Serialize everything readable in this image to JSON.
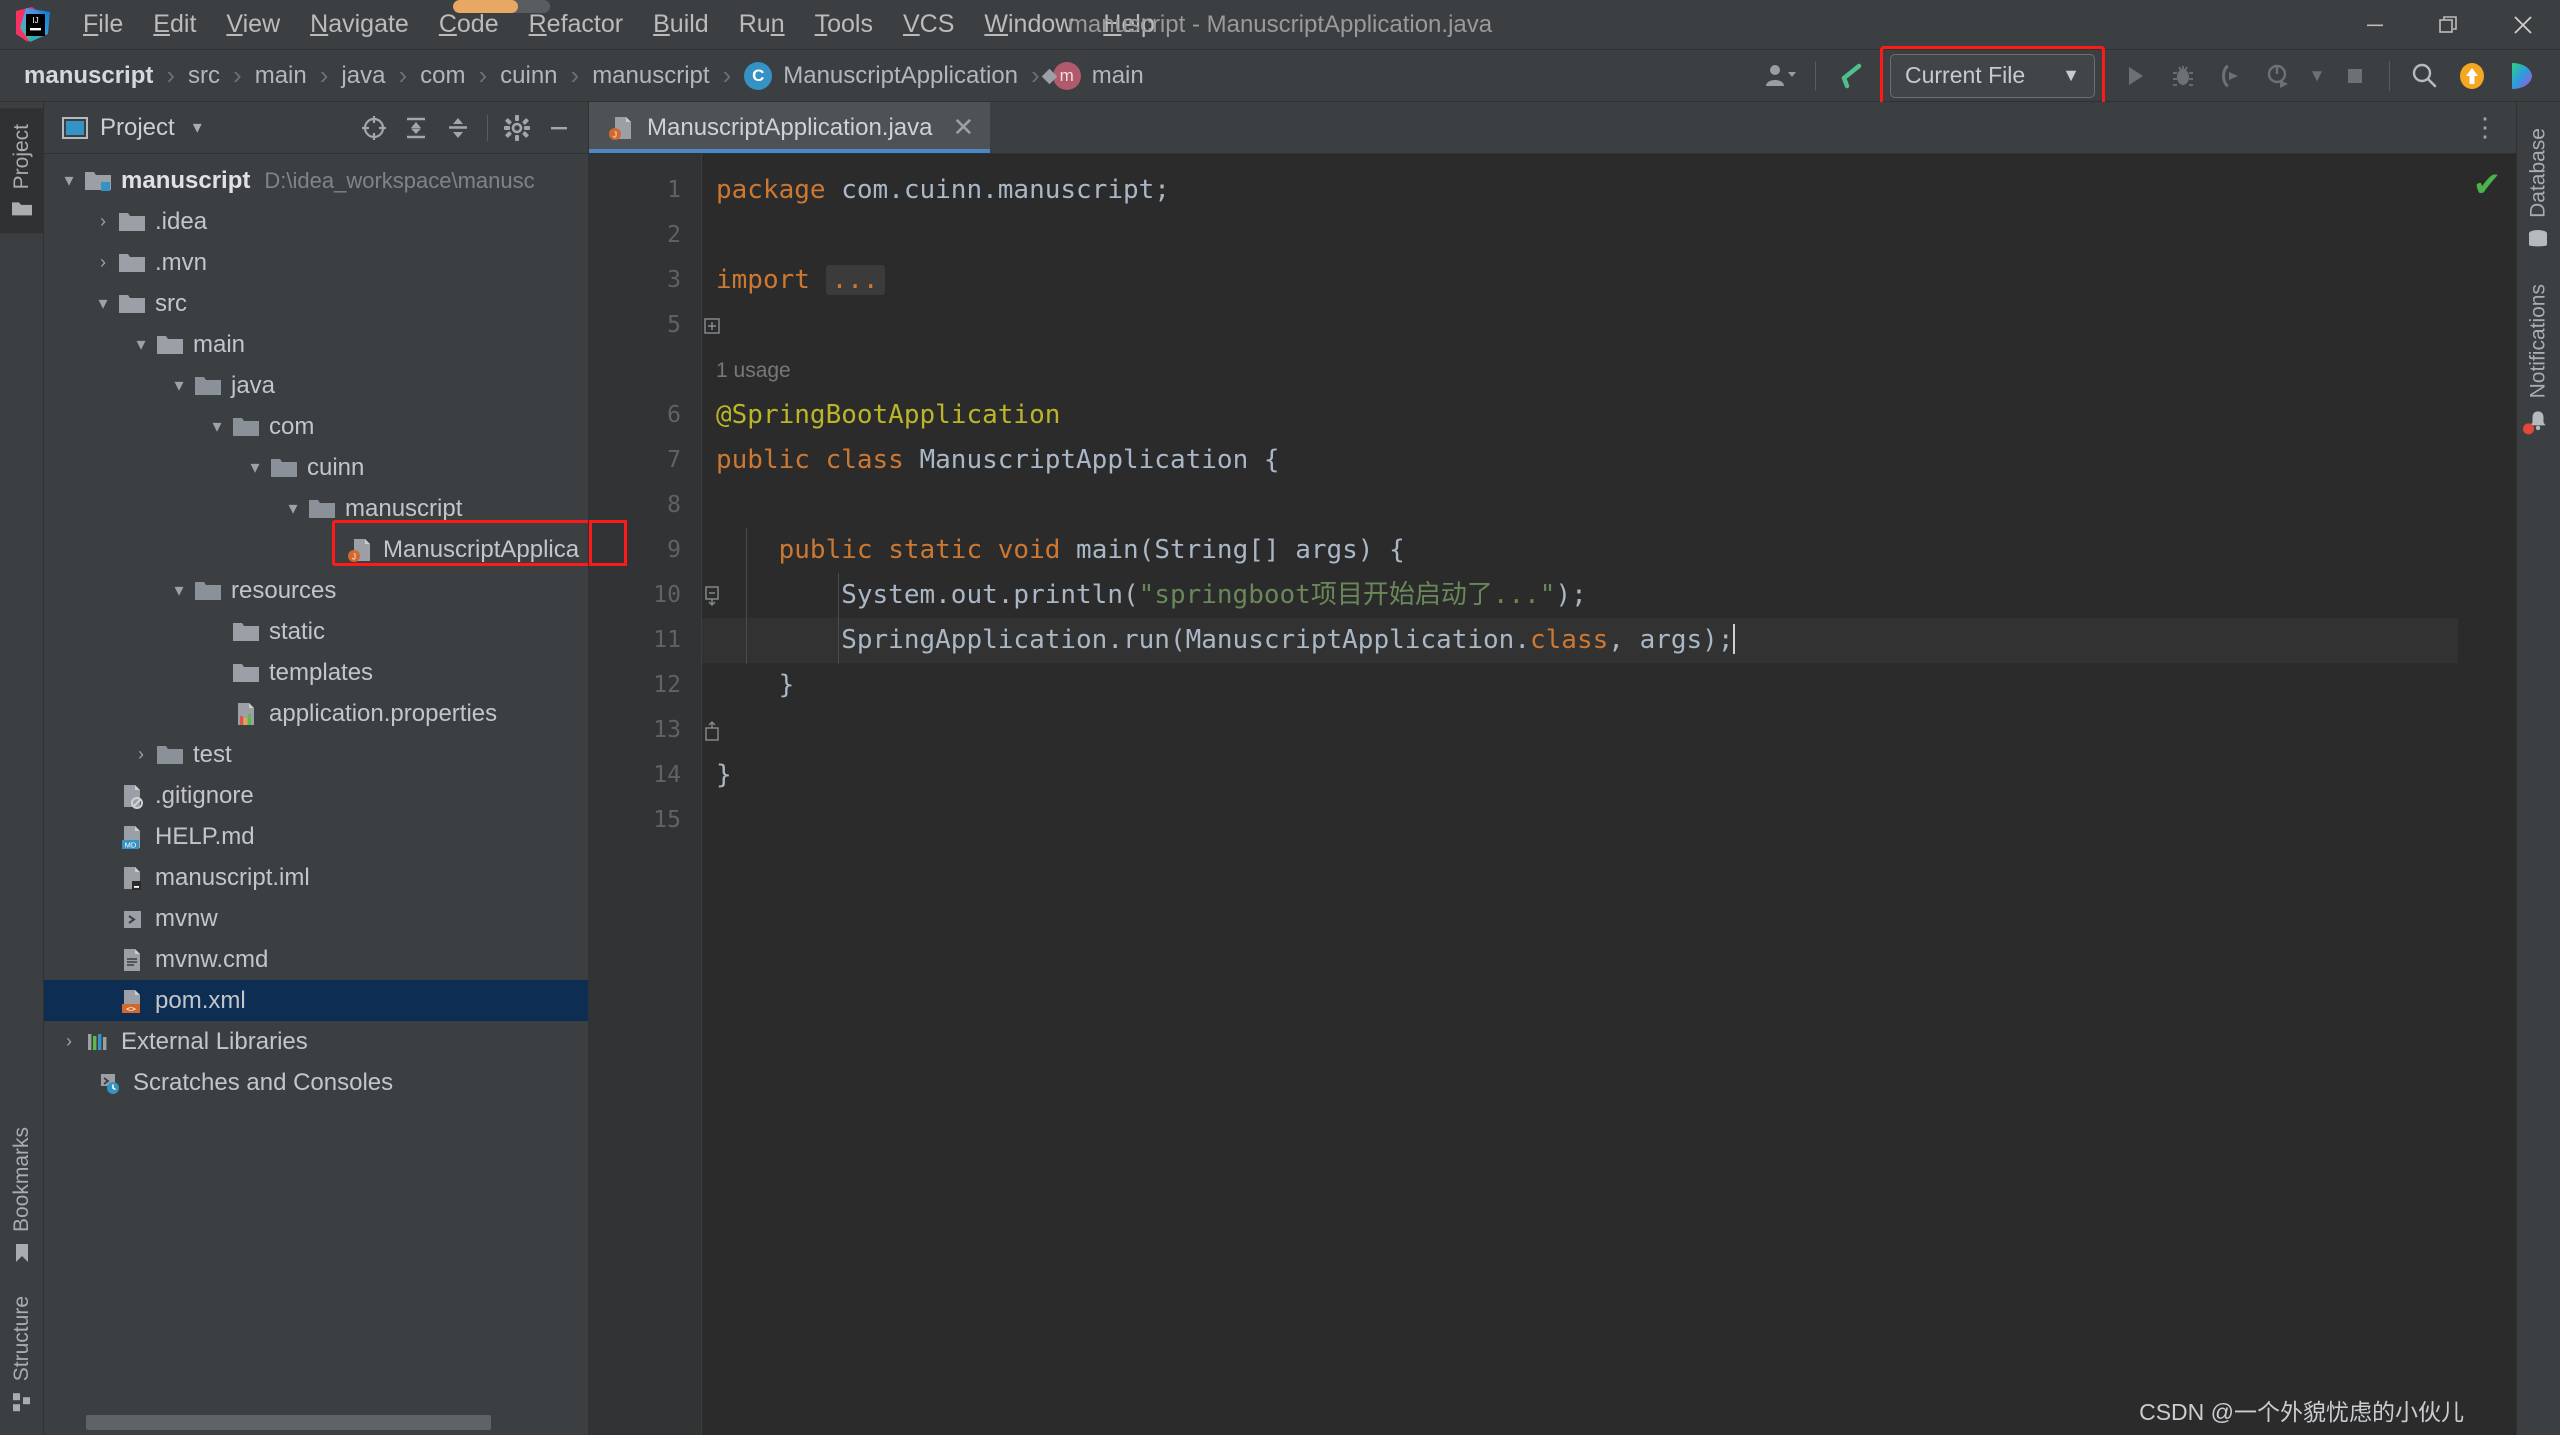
{
  "window": {
    "title": "manuscript - ManuscriptApplication.java",
    "minimize_label": "—",
    "maximize_label": "❐",
    "close_label": "✕"
  },
  "menubar": {
    "items": [
      {
        "label": "File",
        "mnemonic": "F"
      },
      {
        "label": "Edit",
        "mnemonic": "E"
      },
      {
        "label": "View",
        "mnemonic": "V"
      },
      {
        "label": "Navigate",
        "mnemonic": "N"
      },
      {
        "label": "Code",
        "mnemonic": "C"
      },
      {
        "label": "Refactor",
        "mnemonic": "R"
      },
      {
        "label": "Build",
        "mnemonic": "B"
      },
      {
        "label": "Run",
        "mnemonic": "n"
      },
      {
        "label": "Tools",
        "mnemonic": "T"
      },
      {
        "label": "VCS",
        "mnemonic": "V"
      },
      {
        "label": "Window",
        "mnemonic": "W"
      },
      {
        "label": "Help",
        "mnemonic": "H"
      }
    ]
  },
  "navbar": {
    "breadcrumbs": [
      {
        "label": "manuscript",
        "bold": true,
        "icon": "none"
      },
      {
        "label": "src",
        "bold": false,
        "icon": "none"
      },
      {
        "label": "main",
        "bold": false,
        "icon": "none"
      },
      {
        "label": "java",
        "bold": false,
        "icon": "none"
      },
      {
        "label": "com",
        "bold": false,
        "icon": "none"
      },
      {
        "label": "cuinn",
        "bold": false,
        "icon": "none"
      },
      {
        "label": "manuscript",
        "bold": false,
        "icon": "none"
      },
      {
        "label": "ManuscriptApplication",
        "bold": false,
        "icon": "class-badge",
        "badge": "C"
      },
      {
        "label": "main",
        "bold": false,
        "icon": "method-badge",
        "badge": "m"
      }
    ],
    "separator": "›",
    "run_config": {
      "label": "Current File",
      "dropdown_arrow": "▼",
      "highlight_color": "#ff1a1a"
    },
    "icons": {
      "user_avatar": "user-avatar-icon",
      "update_check": "checkmark-arrow-icon",
      "run": "run-icon",
      "debug": "debug-icon",
      "run_coverage": "run-with-coverage-icon",
      "profiler": "profiler-icon",
      "profiler_arrow": "▼",
      "stop": "stop-icon",
      "search": "search-everywhere-icon",
      "updates": "updates-icon",
      "ai_assistant": "ai-assistant-icon"
    }
  },
  "left_rail": {
    "top": [
      {
        "label": "Project",
        "icon": "folder-icon",
        "active": true
      }
    ],
    "bottom": [
      {
        "label": "Bookmarks",
        "icon": "bookmark-icon",
        "active": false
      },
      {
        "label": "Structure",
        "icon": "structure-icon",
        "active": false
      }
    ]
  },
  "right_rail": {
    "items": [
      {
        "label": "Database",
        "icon": "database-icon",
        "badge": false
      },
      {
        "label": "Notifications",
        "icon": "bell-icon",
        "badge": true
      }
    ]
  },
  "project_panel": {
    "title": "Project",
    "dropdown_arrow": "▾",
    "toolbar": [
      {
        "name": "select-opened-file-icon",
        "glyph": "⊕"
      },
      {
        "name": "expand-all-icon",
        "glyph": "⇲"
      },
      {
        "name": "collapse-all-icon",
        "glyph": "⇱"
      },
      {
        "name": "settings-gear-icon",
        "glyph": "⚙"
      },
      {
        "name": "hide-panel-icon",
        "glyph": "—"
      }
    ],
    "tree": [
      {
        "label": "manuscript",
        "note": "D:\\idea_workspace\\manusc",
        "depth": 0,
        "arrow": "down",
        "icon": "module-folder-icon",
        "bold": true,
        "selected": false
      },
      {
        "label": ".idea",
        "note": "",
        "depth": 1,
        "arrow": "right",
        "icon": "folder-icon",
        "bold": false,
        "selected": false
      },
      {
        "label": ".mvn",
        "note": "",
        "depth": 1,
        "arrow": "right",
        "icon": "folder-icon",
        "bold": false,
        "selected": false
      },
      {
        "label": "src",
        "note": "",
        "depth": 1,
        "arrow": "down",
        "icon": "folder-icon",
        "bold": false,
        "selected": false
      },
      {
        "label": "main",
        "note": "",
        "depth": 2,
        "arrow": "down",
        "icon": "folder-icon",
        "bold": false,
        "selected": false
      },
      {
        "label": "java",
        "note": "",
        "depth": 3,
        "arrow": "down",
        "icon": "source-folder-icon",
        "bold": false,
        "selected": false
      },
      {
        "label": "com",
        "note": "",
        "depth": 4,
        "arrow": "down",
        "icon": "package-folder-icon",
        "bold": false,
        "selected": false
      },
      {
        "label": "cuinn",
        "note": "",
        "depth": 5,
        "arrow": "down",
        "icon": "package-folder-icon",
        "bold": false,
        "selected": false
      },
      {
        "label": "manuscript",
        "note": "",
        "depth": 6,
        "arrow": "down",
        "icon": "package-folder-icon",
        "bold": false,
        "selected": false
      },
      {
        "label": "ManuscriptApplica",
        "note": "",
        "depth": 7,
        "arrow": "none",
        "icon": "java-spring-class-icon",
        "bold": false,
        "selected": false,
        "highlighted": true
      },
      {
        "label": "resources",
        "note": "",
        "depth": 3,
        "arrow": "down",
        "icon": "resource-folder-icon",
        "bold": false,
        "selected": false
      },
      {
        "label": "static",
        "note": "",
        "depth": 4,
        "arrow": "none",
        "icon": "folder-icon",
        "bold": false,
        "selected": false
      },
      {
        "label": "templates",
        "note": "",
        "depth": 4,
        "arrow": "none",
        "icon": "folder-icon",
        "bold": false,
        "selected": false
      },
      {
        "label": "application.properties",
        "note": "",
        "depth": 4,
        "arrow": "none",
        "icon": "properties-file-icon",
        "bold": false,
        "selected": false
      },
      {
        "label": "test",
        "note": "",
        "depth": 2,
        "arrow": "right",
        "icon": "test-folder-icon",
        "bold": false,
        "selected": false
      },
      {
        "label": ".gitignore",
        "note": "",
        "depth": 1,
        "arrow": "none",
        "icon": "gitignore-file-icon",
        "bold": false,
        "selected": false
      },
      {
        "label": "HELP.md",
        "note": "",
        "depth": 1,
        "arrow": "none",
        "icon": "markdown-file-icon",
        "bold": false,
        "selected": false
      },
      {
        "label": "manuscript.iml",
        "note": "",
        "depth": 1,
        "arrow": "none",
        "icon": "iml-file-icon",
        "bold": false,
        "selected": false
      },
      {
        "label": "mvnw",
        "note": "",
        "depth": 1,
        "arrow": "none",
        "icon": "shell-script-icon",
        "bold": false,
        "selected": false
      },
      {
        "label": "mvnw.cmd",
        "note": "",
        "depth": 1,
        "arrow": "none",
        "icon": "cmd-file-icon",
        "bold": false,
        "selected": false
      },
      {
        "label": "pom.xml",
        "note": "",
        "depth": 1,
        "arrow": "none",
        "icon": "xml-file-icon",
        "bold": false,
        "selected": true
      },
      {
        "label": "External Libraries",
        "note": "",
        "depth": 0,
        "arrow": "right",
        "icon": "libraries-icon",
        "bold": false,
        "selected": false
      },
      {
        "label": "Scratches and Consoles",
        "note": "",
        "depth": 0,
        "arrow": "none",
        "icon": "scratches-icon",
        "bold": false,
        "selected": false
      }
    ]
  },
  "editor": {
    "tab": {
      "label": "ManuscriptApplication.java",
      "icon": "java-spring-class-icon",
      "close": "✕"
    },
    "options_icon": "⋮",
    "inspection_status": "✔",
    "line_numbers": [
      "1",
      "2",
      "3",
      "5",
      "6",
      "7",
      "8",
      "9",
      "10",
      "11",
      "12",
      "13",
      "14",
      "15"
    ],
    "usage_hint": "1 usage",
    "code_lines": [
      {
        "n": "1",
        "tokens": [
          {
            "t": "package ",
            "c": "kw"
          },
          {
            "t": "com.cuinn.manuscript;",
            "c": "txt"
          }
        ]
      },
      {
        "n": "2",
        "tokens": []
      },
      {
        "n": "3",
        "tokens": [
          {
            "t": "import ",
            "c": "kw"
          },
          {
            "t": "...",
            "c": "folded"
          }
        ],
        "fold": "plus"
      },
      {
        "n": "5",
        "tokens": []
      },
      {
        "n": "usage",
        "tokens": [
          {
            "t": "1 usage",
            "c": "hint"
          }
        ]
      },
      {
        "n": "6",
        "tokens": [
          {
            "t": "@SpringBootApplication",
            "c": "ann"
          }
        ]
      },
      {
        "n": "7",
        "tokens": [
          {
            "t": "public class ",
            "c": "kw"
          },
          {
            "t": "ManuscriptApplication {",
            "c": "txt"
          }
        ]
      },
      {
        "n": "8",
        "tokens": []
      },
      {
        "n": "9",
        "tokens": [
          {
            "t": "    public static void ",
            "c": "kw"
          },
          {
            "t": "main(String[] args) {",
            "c": "txt"
          }
        ],
        "fold": "minus"
      },
      {
        "n": "10",
        "tokens": [
          {
            "t": "        System.out.println(",
            "c": "txt"
          },
          {
            "t": "\"springboot项目开始启动了...\"",
            "c": "str"
          },
          {
            "t": ");",
            "c": "txt"
          }
        ]
      },
      {
        "n": "11",
        "tokens": [
          {
            "t": "        SpringApplication.run(ManuscriptApplication.",
            "c": "txt"
          },
          {
            "t": "class",
            "c": "kw"
          },
          {
            "t": ", args);",
            "c": "txt"
          }
        ],
        "highlight": true,
        "caret": true
      },
      {
        "n": "12",
        "tokens": [
          {
            "t": "    }",
            "c": "txt"
          }
        ],
        "fold": "end"
      },
      {
        "n": "13",
        "tokens": []
      },
      {
        "n": "14",
        "tokens": [
          {
            "t": "}",
            "c": "txt"
          }
        ]
      },
      {
        "n": "15",
        "tokens": []
      }
    ]
  },
  "watermark": {
    "text": "CSDN @一个外貌忧虑的小伙儿"
  },
  "colors": {
    "background": "#3c3f41",
    "editor_background": "#2b2b2b",
    "gutter_background": "#313335",
    "selection": "#0d2d52",
    "highlight_red": "#ff1a1a",
    "accent_blue": "#4a88c7",
    "keyword_orange": "#cc7832",
    "string_green": "#6a8759",
    "annotation_yellow": "#bbb529",
    "text_gray": "#a9b7c6",
    "ok_green": "#4ab44a"
  }
}
